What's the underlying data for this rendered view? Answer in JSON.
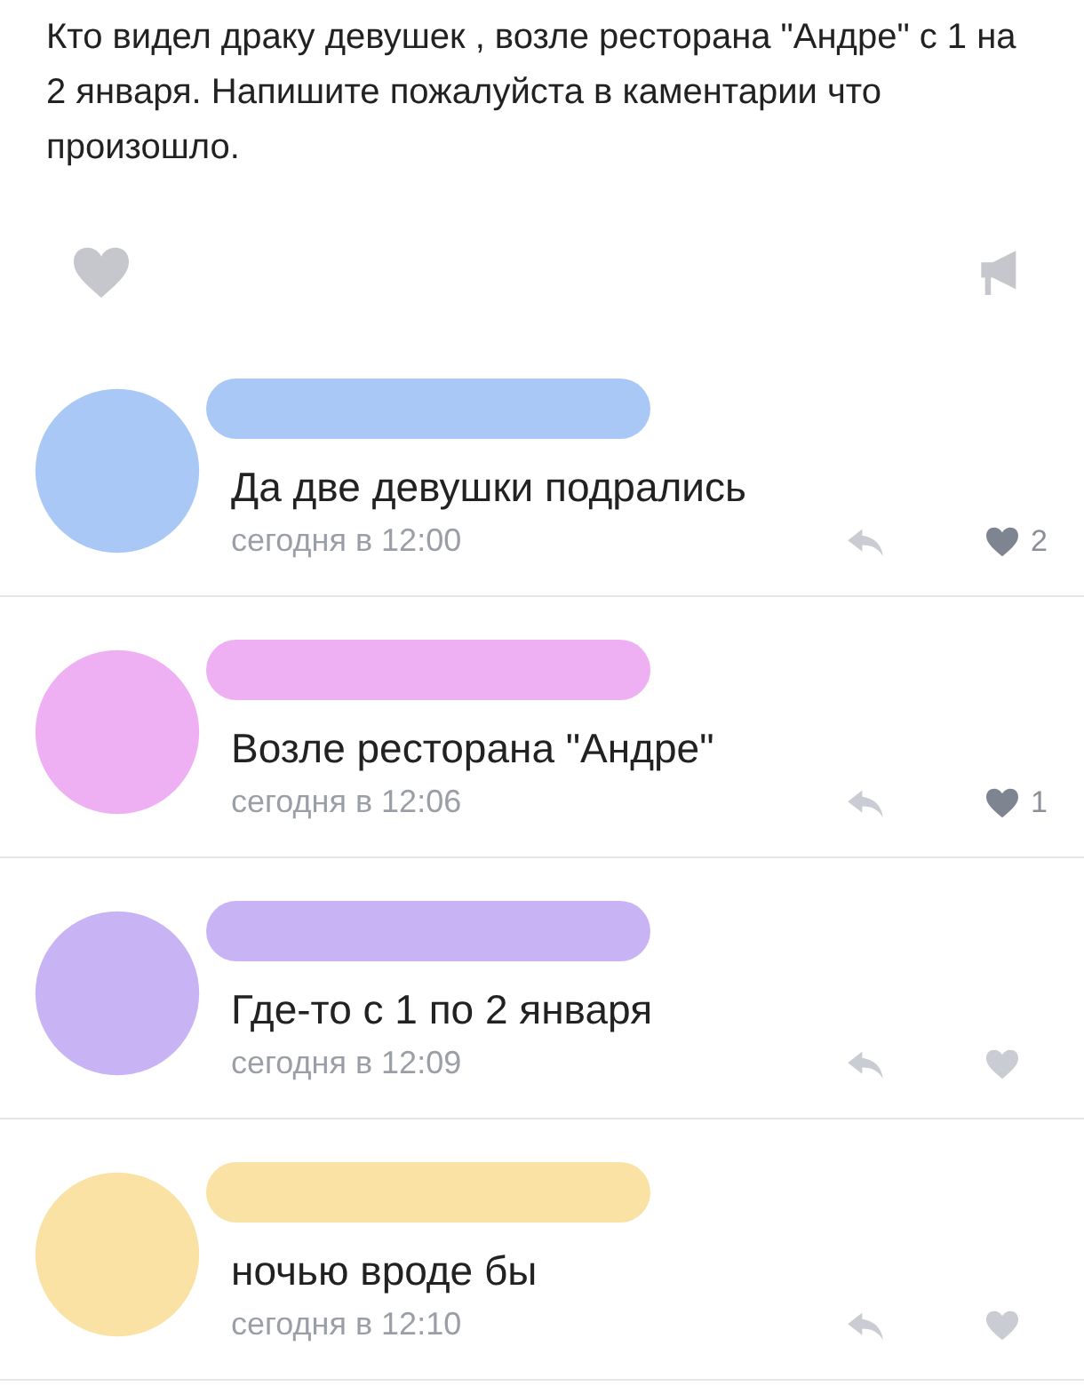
{
  "post": {
    "text": "Кто видел драку девушек , возле ресторана \"Андре\" с 1 на 2 января. Напишите пожалуйста в каментарии что произошло."
  },
  "comments": [
    {
      "color": "#a9c8f5",
      "text": "Да две девушки подрались",
      "time": "сегодня в 12:00",
      "likes": "2"
    },
    {
      "color": "#eeb0f2",
      "text": "Возле ресторана \"Андре\"",
      "time": "сегодня в 12:06",
      "likes": "1"
    },
    {
      "color": "#c8b4f5",
      "text": "Где-то с 1 по 2 января",
      "time": "сегодня в 12:09"
    },
    {
      "color": "#fae1a4",
      "text": "ночью вроде бы",
      "time": "сегодня в 12:10"
    }
  ]
}
